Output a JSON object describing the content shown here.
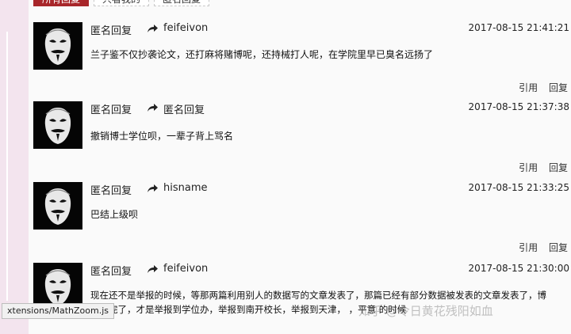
{
  "tabs": [
    "所有回复",
    "只看我的",
    "匿名回复"
  ],
  "comments": [
    {
      "author": "匿名回复",
      "reply_to": "feifeivon",
      "time": "2017-08-15 21:41:21",
      "text": "兰子鉴不仅抄袭论文，还打麻将赌博呢，还持械打人呢，在学院里早已臭名远扬了",
      "actions": [
        "引用",
        "回复"
      ]
    },
    {
      "author": "匿名回复",
      "reply_to": "匿名回复",
      "time": "2017-08-15 21:37:38",
      "text": "撤销博士学位呗，一辈子背上骂名",
      "actions": [
        "引用",
        "回复"
      ]
    },
    {
      "author": "匿名回复",
      "reply_to": "hisname",
      "time": "2017-08-15 21:33:25",
      "text": "巴结上级呗",
      "actions": [
        "引用",
        "回复"
      ]
    },
    {
      "author": "匿名回复",
      "reply_to": "feifeivon",
      "time": "2017-08-15 21:30:00",
      "text_line1": "现在还不是举报的时候，等那两篇利用别人的数据写的文章发表了，那篇已经有部分数据被发表的文章发表了，博",
      "text_line2": "文写完了，才是举报到学位办，举报到南开校长，举报到天津，    ，平意    的时候"
    }
  ],
  "status_tip": "xtensions/MathZoom.js",
  "watermark": "知乎 @令日黄花残阳如血",
  "icons": {
    "avatar": "guy-fawkes-mask-icon",
    "reply": "share-arrow-icon"
  }
}
